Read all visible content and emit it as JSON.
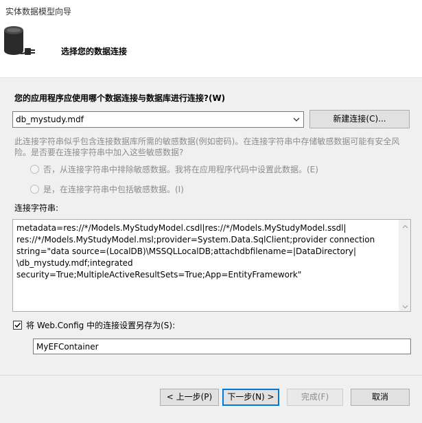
{
  "window": {
    "title": "实体数据模型向导"
  },
  "header": {
    "icon": "database-connect-icon",
    "step_title": "选择您的数据连接"
  },
  "connection": {
    "question": "您的应用程序应使用哪个数据连接与数据库进行连接?(W)",
    "selected": "db_mystudy.mdf",
    "new_connection_label": "新建连接(C)..."
  },
  "sensitive": {
    "warning": "此连接字符串似乎包含连接数据库所需的敏感数据(例如密码)。在连接字符串中存储敏感数据可能有安全风险。是否要在连接字符串中加入这些敏感数据?",
    "option_no": "否，从连接字符串中排除敏感数据。我将在应用程序代码中设置此数据。(E)",
    "option_yes": "是，在连接字符串中包括敏感数据。(I)"
  },
  "connection_string": {
    "label": "连接字符串:",
    "value": "metadata=res://*/Models.MyStudyModel.csdl|res://*/Models.MyStudyModel.ssdl|\nres://*/Models.MyStudyModel.msl;provider=System.Data.SqlClient;provider connection\nstring=\"data source=(LocalDB)\\MSSQLLocalDB;attachdbfilename=|DataDirectory|\n\\db_mystudy.mdf;integrated\nsecurity=True;MultipleActiveResultSets=True;App=EntityFramework\""
  },
  "save": {
    "label": "将 Web.Config 中的连接设置另存为(S):",
    "checked": true,
    "value": "MyEFContainer"
  },
  "buttons": {
    "back": "< 上一步(P)",
    "next": "下一步(N) >",
    "finish": "完成(F)",
    "cancel": "取消"
  }
}
